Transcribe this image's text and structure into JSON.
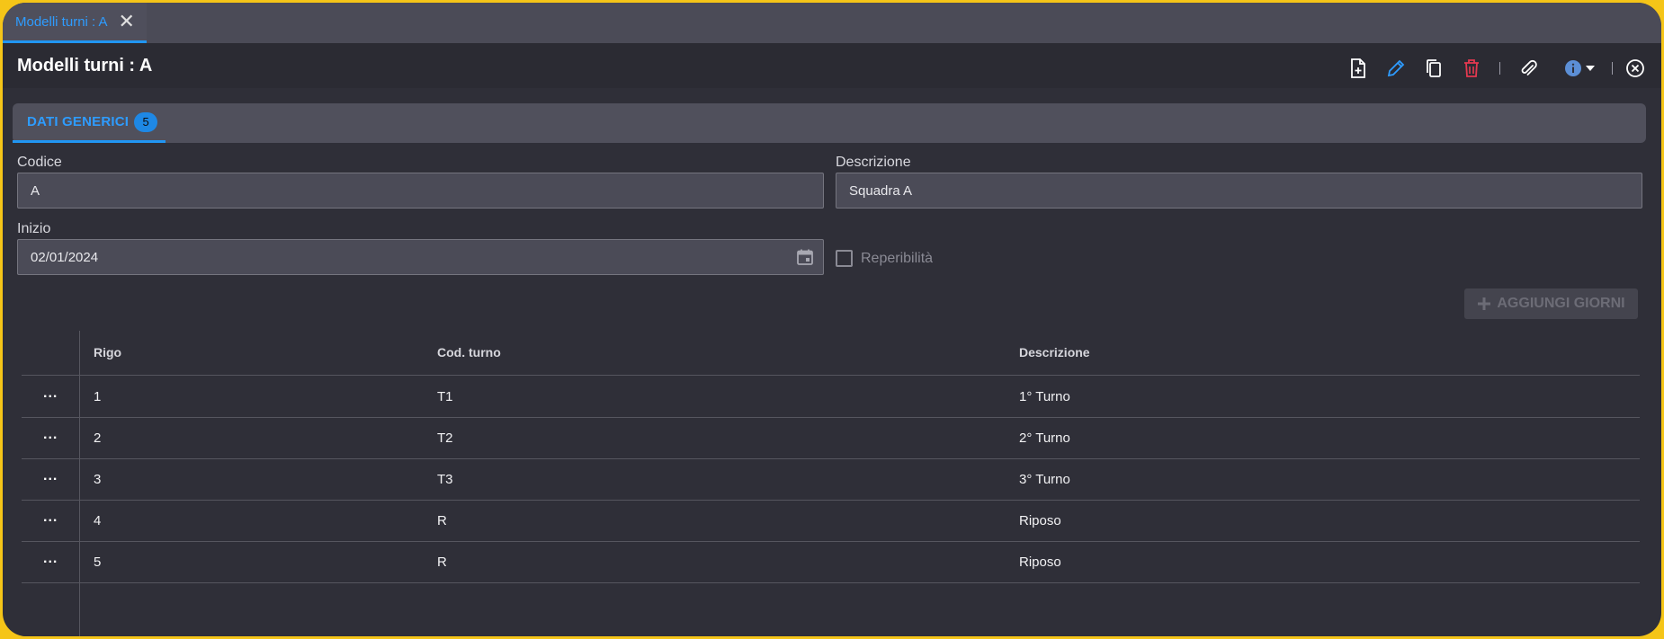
{
  "tab": {
    "label": "Modelli turni : A",
    "close_icon": "close-icon"
  },
  "header": {
    "title": "Modelli turni : A"
  },
  "toolbar": {
    "icons": [
      "new-document-icon",
      "edit-pencil-icon",
      "copy-icon",
      "delete-trash-icon",
      "attach-paperclip-icon",
      "info-icon",
      "close-circle-icon"
    ],
    "colors": {
      "edit": "#2e9cff",
      "delete": "#e53950",
      "info": "#5c8fd6",
      "default": "#ffffff"
    }
  },
  "section": {
    "label": "DATI GENERICI",
    "badge": "5"
  },
  "form": {
    "codice": {
      "label": "Codice",
      "value": "A"
    },
    "descrizione": {
      "label": "Descrizione",
      "value": "Squadra A"
    },
    "inizio": {
      "label": "Inizio",
      "value": "02/01/2024"
    },
    "reperibilita": {
      "label": "Reperibilità",
      "checked": false
    }
  },
  "actions": {
    "add_days": "AGGIUNGI GIORNI"
  },
  "grid": {
    "columns": {
      "rigo": "Rigo",
      "cod_turno": "Cod. turno",
      "descrizione": "Descrizione"
    },
    "row_menu": "...",
    "rows": [
      {
        "rigo": "1",
        "cod_turno": "T1",
        "descrizione": "1° Turno"
      },
      {
        "rigo": "2",
        "cod_turno": "T2",
        "descrizione": "2° Turno"
      },
      {
        "rigo": "3",
        "cod_turno": "T3",
        "descrizione": "3° Turno"
      },
      {
        "rigo": "4",
        "cod_turno": "R",
        "descrizione": "Riposo"
      },
      {
        "rigo": "5",
        "cod_turno": "R",
        "descrizione": "Riposo"
      }
    ]
  }
}
